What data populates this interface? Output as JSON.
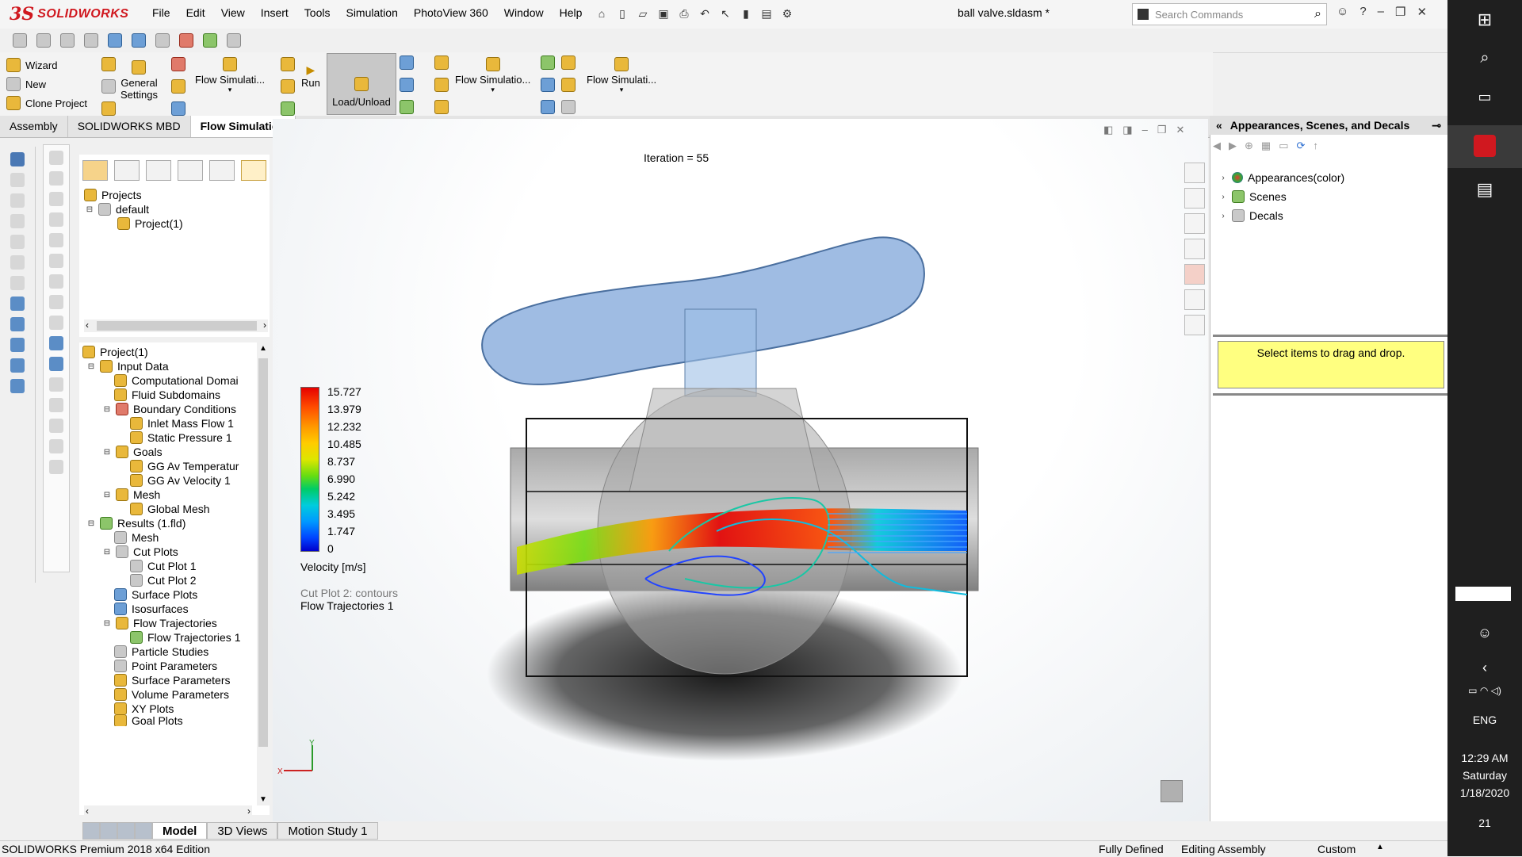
{
  "app": {
    "brand_ds": "3S",
    "brand_name": "SOLIDWORKS",
    "menu": [
      "File",
      "Edit",
      "View",
      "Insert",
      "Tools",
      "Simulation",
      "PhotoView 360",
      "Window",
      "Help"
    ],
    "document_title": "ball valve.sldasm *",
    "search_placeholder": "Search Commands"
  },
  "command_manager": {
    "col1": [
      "Wizard",
      "New",
      "Clone Project"
    ],
    "general_settings": [
      "General",
      "Settings"
    ],
    "flow_sim_1": "Flow Simulati...",
    "run": "Run",
    "load_unload": "Load/Unload",
    "flow_sim_2": "Flow Simulatio...",
    "flow_sim_3": "Flow Simulati..."
  },
  "tabs": [
    {
      "label": "Assembly",
      "active": false
    },
    {
      "label": "SOLIDWORKS MBD",
      "active": false
    },
    {
      "label": "Flow Simulation",
      "active": true
    }
  ],
  "tree_top": {
    "projects": "Projects",
    "default": "default",
    "project1": "Project(1)"
  },
  "tree_main": {
    "root": "Project(1)",
    "input_data": "Input Data",
    "computational_domain": "Computational Domai",
    "fluid_subdomains": "Fluid Subdomains",
    "boundary_conditions": "Boundary Conditions",
    "inlet_mass_flow": "Inlet Mass Flow 1",
    "static_pressure": "Static Pressure 1",
    "goals": "Goals",
    "gg_temp": "GG Av Temperatur",
    "gg_vel": "GG Av Velocity 1",
    "mesh": "Mesh",
    "global_mesh": "Global Mesh",
    "results": "Results (1.fld)",
    "results_mesh": "Mesh",
    "cut_plots": "Cut Plots",
    "cut_plot_1": "Cut Plot 1",
    "cut_plot_2": "Cut Plot 2",
    "surface_plots": "Surface Plots",
    "isosurfaces": "Isosurfaces",
    "flow_trajectories": "Flow Trajectories",
    "flow_trajectories_1": "Flow Trajectories 1",
    "particle_studies": "Particle Studies",
    "point_parameters": "Point Parameters",
    "surface_parameters": "Surface Parameters",
    "volume_parameters": "Volume Parameters",
    "xy_plots": "XY Plots",
    "goal_plots": "Goal Plots"
  },
  "bottom_tabs": [
    {
      "label": "Model",
      "active": true
    },
    {
      "label": "3D Views",
      "active": false
    },
    {
      "label": "Motion Study 1",
      "active": false
    }
  ],
  "viewport": {
    "iteration": "Iteration = 55",
    "legend_values": [
      "15.727",
      "13.979",
      "12.232",
      "10.485",
      "8.737",
      "6.990",
      "5.242",
      "3.495",
      "1.747",
      "0"
    ],
    "legend_title": "Velocity [m/s]",
    "plot_note_1": "Cut Plot 2: contours",
    "plot_note_2": "Flow Trajectories 1",
    "triad_y": "Y",
    "triad_x": "X"
  },
  "right_panel": {
    "title": "Appearances, Scenes, and Decals",
    "items": [
      "Appearances(color)",
      "Scenes",
      "Decals"
    ],
    "hint": "Select items to drag and drop."
  },
  "status_bar": {
    "edition": "SOLIDWORKS Premium 2018 x64 Edition",
    "fully_defined": "Fully Defined",
    "editing": "Editing Assembly",
    "units": "Custom"
  },
  "taskbar": {
    "language": "ENG",
    "time": "12:29 AM",
    "day": "Saturday",
    "date": "1/18/2020",
    "notif_count": "21"
  }
}
